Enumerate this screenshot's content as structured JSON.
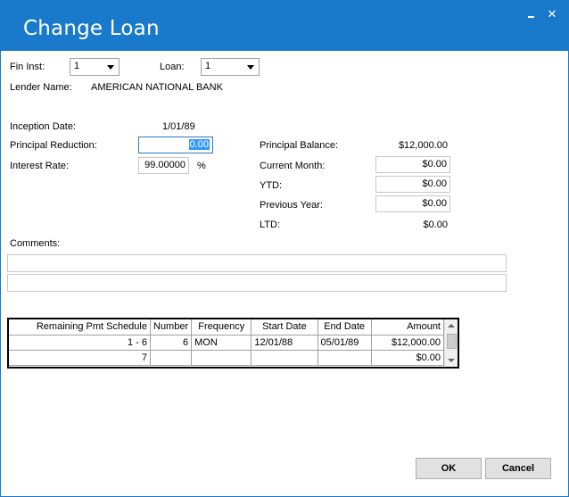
{
  "window": {
    "title": "Change Loan",
    "minimize_glyph": "",
    "close_glyph": "✕"
  },
  "header": {
    "fin_inst_label": "Fin Inst:",
    "fin_inst_value": "1",
    "loan_label": "Loan:",
    "loan_value": "1",
    "lender_name_label": "Lender Name:",
    "lender_name_value": "AMERICAN NATIONAL BANK"
  },
  "left": {
    "inception_date_label": "Inception Date:",
    "inception_date_value": "1/01/89",
    "principal_reduction_label": "Principal Reduction:",
    "principal_reduction_value": "0.00",
    "interest_rate_label": "Interest Rate:",
    "interest_rate_value": "99.00000",
    "interest_rate_unit": "%"
  },
  "right": {
    "principal_balance_label": "Principal Balance:",
    "principal_balance_value": "$12,000.00",
    "current_month_label": "Current Month:",
    "current_month_value": "$0.00",
    "ytd_label": "YTD:",
    "ytd_value": "$0.00",
    "previous_year_label": "Previous Year:",
    "previous_year_value": "$0.00",
    "ltd_label": "LTD:",
    "ltd_value": "$0.00"
  },
  "comments": {
    "label": "Comments:",
    "line1": "",
    "line2": ""
  },
  "schedule": {
    "columns": [
      "Remaining Pmt Schedule",
      "Number",
      "Frequency",
      "Start Date",
      "End Date",
      "Amount"
    ],
    "rows": [
      [
        "1 -   6",
        "6",
        "MON",
        "12/01/88",
        "05/01/89",
        "$12,000.00"
      ],
      [
        "7",
        "",
        "",
        "",
        "",
        "$0.00"
      ]
    ]
  },
  "buttons": {
    "ok": "OK",
    "cancel": "Cancel"
  }
}
